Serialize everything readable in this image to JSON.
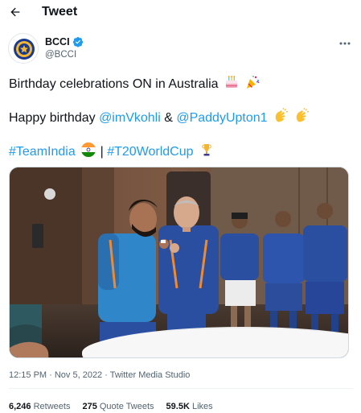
{
  "header": {
    "title": "Tweet"
  },
  "author": {
    "display_name": "BCCI",
    "handle": "@BCCI",
    "verified": true
  },
  "tweet": {
    "line1_text": "Birthday celebrations ON in Australia",
    "line1_emojis": [
      "birthday-cake",
      "party-popper"
    ],
    "line2_prefix": "Happy birthday ",
    "mention1": "@imVkohli",
    "line2_amp": " & ",
    "mention2": "@PaddyUpton1",
    "line2_emojis": [
      "clapping-hands",
      "clapping-hands"
    ],
    "hashtag1": "#TeamIndia",
    "line3_sep": " | ",
    "hashtag2": "#T20WorldCup",
    "line3_emojis": [
      "india-flag",
      "trophy"
    ]
  },
  "meta": {
    "timestamp": "12:15 PM · Nov 5, 2022 · Twitter Media Studio"
  },
  "stats": {
    "retweets_count": "6,246",
    "retweets_label": "Retweets",
    "quotes_count": "275",
    "quotes_label": "Quote Tweets",
    "likes_count": "59.5K",
    "likes_label": "Likes"
  },
  "colors": {
    "accent": "#1d9bf0",
    "text": "#0f1419",
    "muted": "#536471",
    "jersey": "#1f3f9a"
  }
}
